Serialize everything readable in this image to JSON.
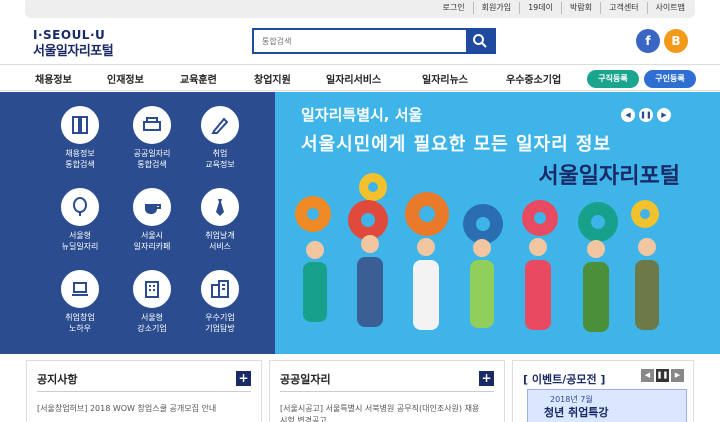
{
  "top_links": [
    "로그인",
    "회원가입",
    "19데이",
    "박람회",
    "고객센터",
    "사이트맵"
  ],
  "logo": {
    "line1": "I·SEOUL·U",
    "line2": "서울일자리포털"
  },
  "search": {
    "placeholder": "통합검색"
  },
  "social": {
    "facebook": "f",
    "blog": "B"
  },
  "nav": {
    "items": [
      "채용정보",
      "인재정보",
      "교육훈련",
      "창업지원",
      "일자리서비스",
      "일자리뉴스",
      "우수중소기업"
    ],
    "job_register": "구직등록",
    "hire_register": "구인등록"
  },
  "quick_menu": [
    {
      "line1": "채용정보",
      "line2": "통합검색",
      "icon": "binder-icon"
    },
    {
      "line1": "공공일자리",
      "line2": "통합검색",
      "icon": "printer-icon"
    },
    {
      "line1": "취업",
      "line2": "교육정보",
      "icon": "pencil-icon"
    },
    {
      "line1": "서울형",
      "line2": "뉴딜일자리",
      "icon": "balloon-icon"
    },
    {
      "line1": "서울시",
      "line2": "일자리카페",
      "icon": "coffee-icon"
    },
    {
      "line1": "취업날개",
      "line2": "서비스",
      "icon": "tie-icon"
    },
    {
      "line1": "취업창업",
      "line2": "노하우",
      "icon": "laptop-icon"
    },
    {
      "line1": "서울형",
      "line2": "강소기업",
      "icon": "building-icon"
    },
    {
      "line1": "우수기업",
      "line2": "기업탐방",
      "icon": "office-icon"
    }
  ],
  "banner": {
    "subtitle": "일자리특별시, 서울",
    "headline": "서울시민에게 필요한 모든 일자리 정보",
    "portal": "서울일자리포털",
    "prev": "◀",
    "pause": "❚❚",
    "next": "▶"
  },
  "panels": {
    "notice": {
      "title": "공지사항",
      "plus": "+",
      "item": "[서울창업허브] 2018 WOW 창업스쿨 공개모집 안내"
    },
    "public_jobs": {
      "title": "공공일자리",
      "plus": "+",
      "item": "[서울시공고] 서울특별시 서북병원 공무직(대인조사원) 채용시험 변경공고"
    },
    "events": {
      "title": "[ 이벤트/공모전 ]",
      "prev": "◀",
      "pause": "❚❚",
      "next": "▶",
      "date": "2018년 7월",
      "event_title": "청년 취업특강"
    }
  },
  "colors": {
    "brand_navy": "#1a2a66",
    "quick_bg": "#2b4d90",
    "banner_bg": "#3fb4e8",
    "teal": "#1aa58f",
    "blue": "#2e6fd1"
  }
}
